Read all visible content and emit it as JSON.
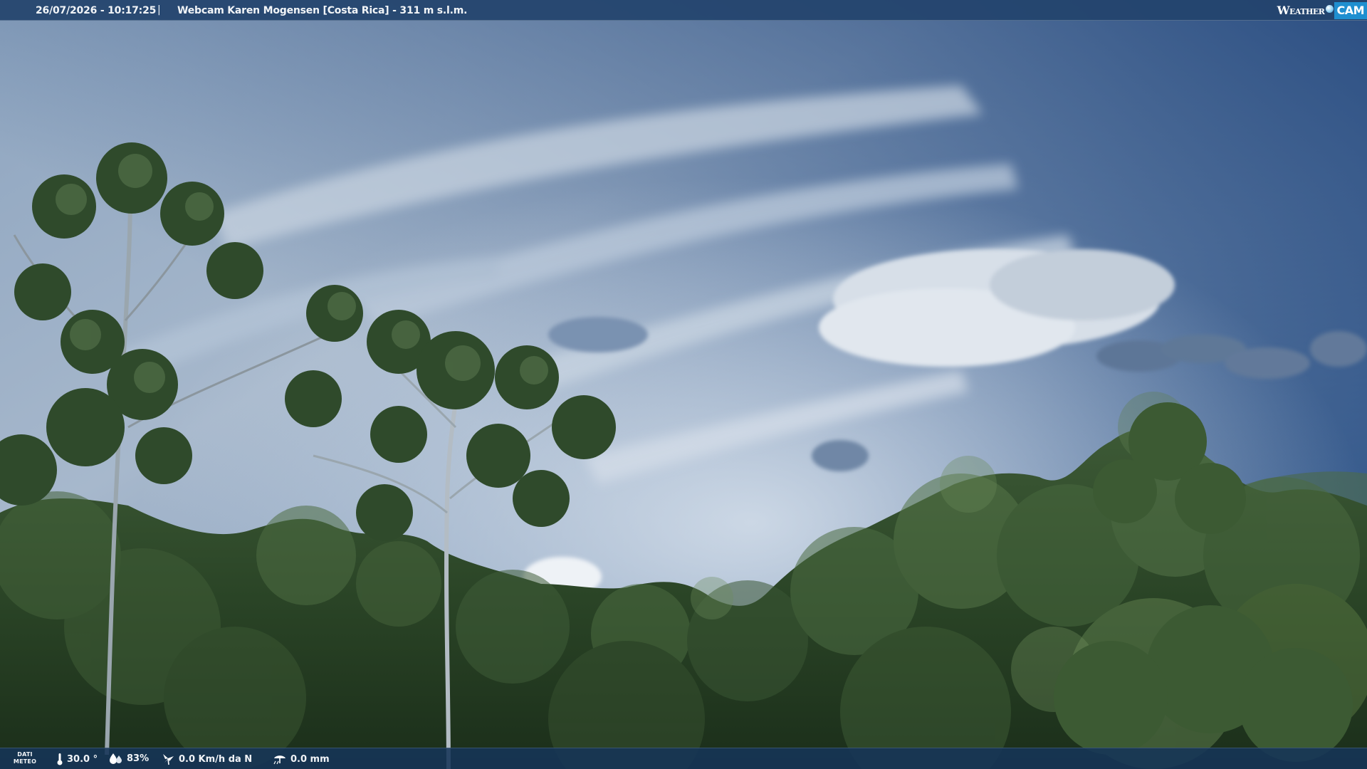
{
  "overlay": {
    "datetime": "26/07/2026 - 10:17:25",
    "separator": "|",
    "title": "Webcam Karen Mogensen [Costa Rica]  - 311 m s.l.m.",
    "brand": {
      "weather": "Weather",
      "cam": "CAM"
    }
  },
  "meteo": {
    "label_line1": "DATI",
    "label_line2": "METEO",
    "temperature": "30.0 °",
    "humidity": "83%",
    "wind": "0.0 Km/h da N",
    "rain": "0.0 mm"
  },
  "icons": {
    "temperature": "thermometer-icon",
    "humidity": "humidity-icon",
    "wind": "wind-icon",
    "rain": "rain-icon",
    "brand": "weathercam-logo-icon"
  },
  "colors": {
    "bar_background": "#23436c",
    "bottom_bar_background": "#163458",
    "brand_cam": "#1f8fd0",
    "text": "#f2f5f8"
  }
}
